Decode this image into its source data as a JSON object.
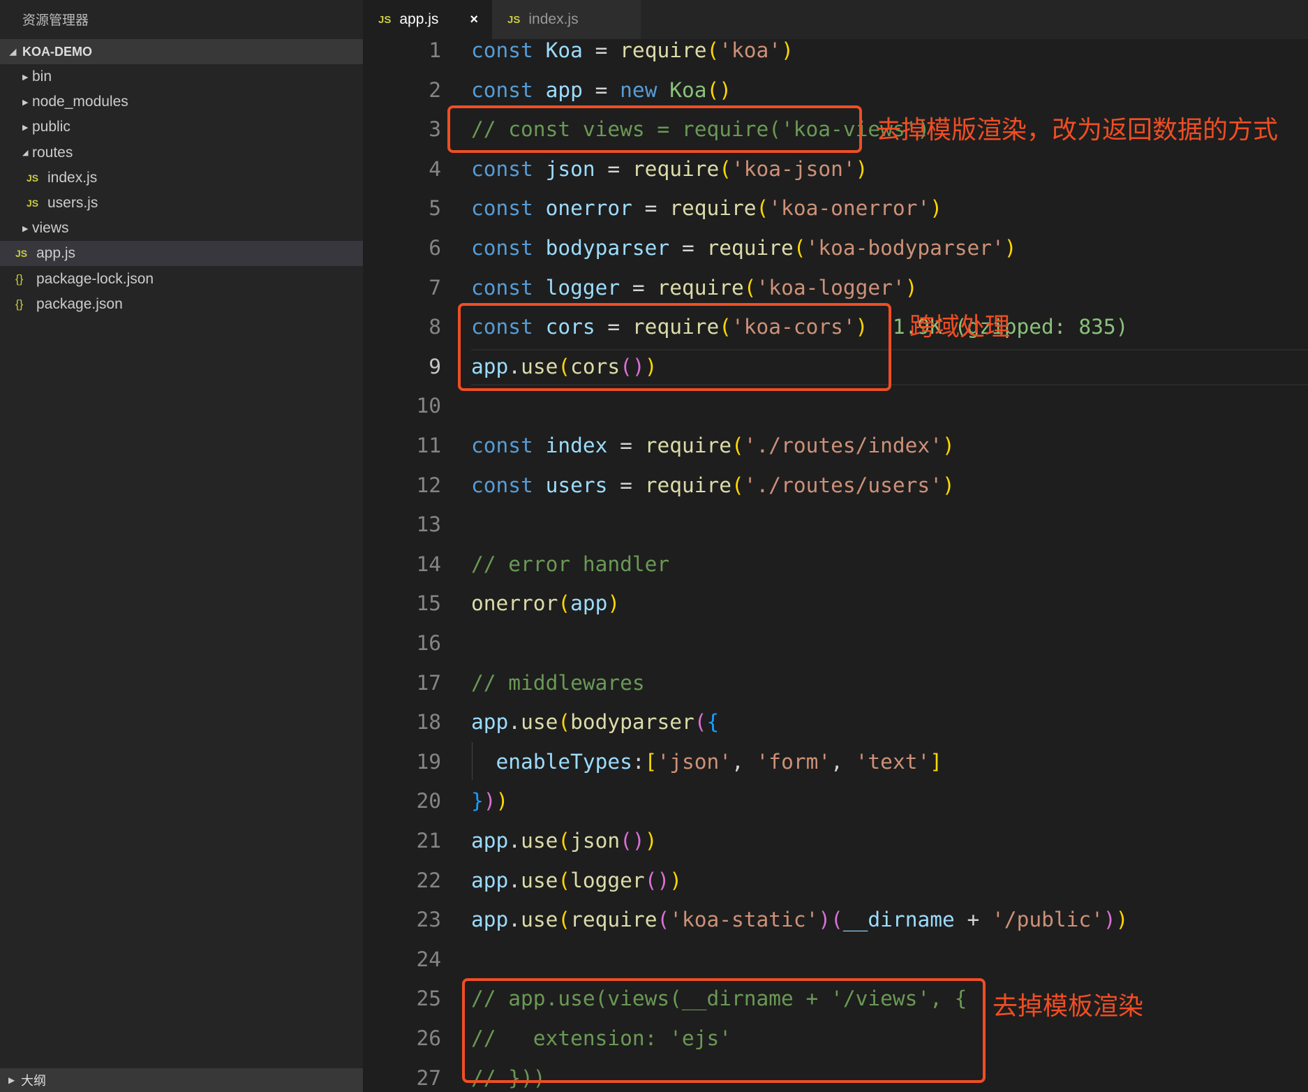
{
  "sidebar": {
    "title": "资源管理器",
    "project": "KOA-DEMO",
    "items": [
      {
        "label": "bin",
        "type": "folder",
        "expanded": false,
        "depth": 1
      },
      {
        "label": "node_modules",
        "type": "folder",
        "expanded": false,
        "depth": 1
      },
      {
        "label": "public",
        "type": "folder",
        "expanded": false,
        "depth": 1
      },
      {
        "label": "routes",
        "type": "folder",
        "expanded": true,
        "depth": 1
      },
      {
        "label": "index.js",
        "type": "js",
        "depth": 2
      },
      {
        "label": "users.js",
        "type": "js",
        "depth": 2
      },
      {
        "label": "views",
        "type": "folder",
        "expanded": false,
        "depth": 1
      },
      {
        "label": "app.js",
        "type": "js",
        "depth": 0,
        "selected": true
      },
      {
        "label": "package-lock.json",
        "type": "json",
        "depth": 0
      },
      {
        "label": "package.json",
        "type": "json",
        "depth": 0
      }
    ],
    "outline": "大纲"
  },
  "tabs": [
    {
      "label": "app.js",
      "icon": "JS",
      "active": true,
      "close": "×"
    },
    {
      "label": "index.js",
      "icon": "JS",
      "active": false
    }
  ],
  "editor": {
    "current_line": 9,
    "lines": [
      [
        [
          "const",
          "k"
        ],
        [
          " ",
          "t"
        ],
        [
          "Koa",
          "v"
        ],
        [
          " = ",
          "t"
        ],
        [
          "require",
          "f"
        ],
        [
          "(",
          "p1"
        ],
        [
          "'koa'",
          "s"
        ],
        [
          ")",
          "p1"
        ]
      ],
      [
        [
          "const",
          "k"
        ],
        [
          " ",
          "t"
        ],
        [
          "app",
          "v"
        ],
        [
          " = ",
          "t"
        ],
        [
          "new",
          "k"
        ],
        [
          " ",
          "t"
        ],
        [
          "Koa",
          "g"
        ],
        [
          "()",
          "p1"
        ]
      ],
      [
        [
          "// const views = require('koa-views')",
          "c"
        ]
      ],
      [
        [
          "const",
          "k"
        ],
        [
          " ",
          "t"
        ],
        [
          "json",
          "v"
        ],
        [
          " = ",
          "t"
        ],
        [
          "require",
          "f"
        ],
        [
          "(",
          "p1"
        ],
        [
          "'koa-json'",
          "s"
        ],
        [
          ")",
          "p1"
        ]
      ],
      [
        [
          "const",
          "k"
        ],
        [
          " ",
          "t"
        ],
        [
          "onerror",
          "v"
        ],
        [
          " = ",
          "t"
        ],
        [
          "require",
          "f"
        ],
        [
          "(",
          "p1"
        ],
        [
          "'koa-onerror'",
          "s"
        ],
        [
          ")",
          "p1"
        ]
      ],
      [
        [
          "const",
          "k"
        ],
        [
          " ",
          "t"
        ],
        [
          "bodyparser",
          "v"
        ],
        [
          " = ",
          "t"
        ],
        [
          "require",
          "f"
        ],
        [
          "(",
          "p1"
        ],
        [
          "'koa-bodyparser'",
          "s"
        ],
        [
          ")",
          "p1"
        ]
      ],
      [
        [
          "const",
          "k"
        ],
        [
          " ",
          "t"
        ],
        [
          "logger",
          "v"
        ],
        [
          " = ",
          "t"
        ],
        [
          "require",
          "f"
        ],
        [
          "(",
          "p1"
        ],
        [
          "'koa-logger'",
          "s"
        ],
        [
          ")",
          "p1"
        ]
      ],
      [
        [
          "const",
          "k"
        ],
        [
          " ",
          "t"
        ],
        [
          "cors",
          "v"
        ],
        [
          " = ",
          "t"
        ],
        [
          "require",
          "f"
        ],
        [
          "(",
          "p1"
        ],
        [
          "'koa-cors'",
          "s"
        ],
        [
          ")",
          "p1"
        ],
        [
          "  1.9K (gzipped: 835)",
          "g"
        ]
      ],
      [
        [
          "app",
          "v"
        ],
        [
          ".",
          "t"
        ],
        [
          "use",
          "f"
        ],
        [
          "(",
          "p1"
        ],
        [
          "cors",
          "f"
        ],
        [
          "()",
          "p2"
        ],
        [
          ")",
          "p1"
        ]
      ],
      [],
      [
        [
          "const",
          "k"
        ],
        [
          " ",
          "t"
        ],
        [
          "index",
          "v"
        ],
        [
          " = ",
          "t"
        ],
        [
          "require",
          "f"
        ],
        [
          "(",
          "p1"
        ],
        [
          "'./routes/index'",
          "s"
        ],
        [
          ")",
          "p1"
        ]
      ],
      [
        [
          "const",
          "k"
        ],
        [
          " ",
          "t"
        ],
        [
          "users",
          "v"
        ],
        [
          " = ",
          "t"
        ],
        [
          "require",
          "f"
        ],
        [
          "(",
          "p1"
        ],
        [
          "'./routes/users'",
          "s"
        ],
        [
          ")",
          "p1"
        ]
      ],
      [],
      [
        [
          "// error handler",
          "c"
        ]
      ],
      [
        [
          "onerror",
          "f"
        ],
        [
          "(",
          "p1"
        ],
        [
          "app",
          "v"
        ],
        [
          ")",
          "p1"
        ]
      ],
      [],
      [
        [
          "// middlewares",
          "c"
        ]
      ],
      [
        [
          "app",
          "v"
        ],
        [
          ".",
          "t"
        ],
        [
          "use",
          "f"
        ],
        [
          "(",
          "p1"
        ],
        [
          "bodyparser",
          "f"
        ],
        [
          "(",
          "p2"
        ],
        [
          "{",
          "p3"
        ]
      ],
      [
        [
          "  ",
          "t"
        ],
        [
          "enableTypes",
          "v"
        ],
        [
          ":",
          "t"
        ],
        [
          "[",
          "p1"
        ],
        [
          "'json'",
          "s"
        ],
        [
          ", ",
          "t"
        ],
        [
          "'form'",
          "s"
        ],
        [
          ", ",
          "t"
        ],
        [
          "'text'",
          "s"
        ],
        [
          "]",
          "p1"
        ]
      ],
      [
        [
          "}",
          "p3"
        ],
        [
          ")",
          "p2"
        ],
        [
          ")",
          "p1"
        ]
      ],
      [
        [
          "app",
          "v"
        ],
        [
          ".",
          "t"
        ],
        [
          "use",
          "f"
        ],
        [
          "(",
          "p1"
        ],
        [
          "json",
          "f"
        ],
        [
          "()",
          "p2"
        ],
        [
          ")",
          "p1"
        ]
      ],
      [
        [
          "app",
          "v"
        ],
        [
          ".",
          "t"
        ],
        [
          "use",
          "f"
        ],
        [
          "(",
          "p1"
        ],
        [
          "logger",
          "f"
        ],
        [
          "()",
          "p2"
        ],
        [
          ")",
          "p1"
        ]
      ],
      [
        [
          "app",
          "v"
        ],
        [
          ".",
          "t"
        ],
        [
          "use",
          "f"
        ],
        [
          "(",
          "p1"
        ],
        [
          "require",
          "f"
        ],
        [
          "(",
          "p2"
        ],
        [
          "'koa-static'",
          "s"
        ],
        [
          ")",
          "p2"
        ],
        [
          "(",
          "p2"
        ],
        [
          "__dirname",
          "v"
        ],
        [
          " + ",
          "t"
        ],
        [
          "'/public'",
          "s"
        ],
        [
          ")",
          "p2"
        ],
        [
          ")",
          "p1"
        ]
      ],
      [],
      [
        [
          "// app.use(views(__dirname + '/views', {",
          "c"
        ]
      ],
      [
        [
          "//   extension: 'ejs'",
          "c"
        ]
      ],
      [
        [
          "// }))",
          "c"
        ]
      ]
    ]
  },
  "annotations": {
    "views_removed": "去掉模版渲染，改为返回数据的方式",
    "cors": "跨域处理",
    "template_removed": "去掉模板渲染"
  },
  "colors": {
    "annotation": "#ef4e24",
    "keyword": "#569cd6",
    "string": "#ce9178",
    "comment": "#6a9955"
  }
}
